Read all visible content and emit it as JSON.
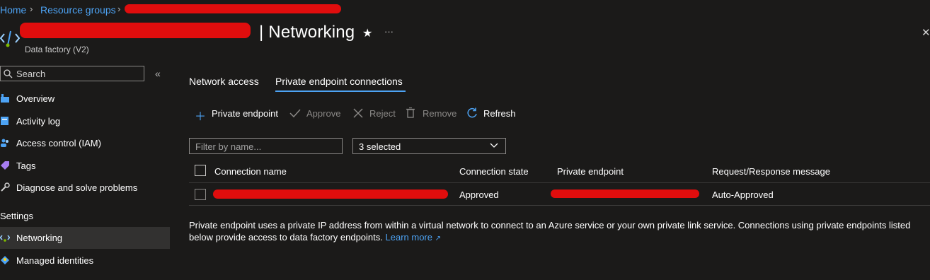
{
  "breadcrumb": {
    "home": "Home",
    "resource_groups": "Resource groups"
  },
  "header": {
    "title": "| Networking",
    "subtitle": "Data factory (V2)",
    "star_glyph": "★",
    "more_glyph": "···",
    "close_glyph": "✕"
  },
  "sidebar": {
    "search_placeholder": "Search",
    "collapse_glyph": "«",
    "items": [
      {
        "label": "Overview",
        "icon": "factory-icon"
      },
      {
        "label": "Activity log",
        "icon": "activity-log-icon"
      },
      {
        "label": "Access control (IAM)",
        "icon": "people-icon"
      },
      {
        "label": "Tags",
        "icon": "tag-icon"
      },
      {
        "label": "Diagnose and solve problems",
        "icon": "wrench-icon"
      }
    ],
    "section_settings": "Settings",
    "settings_items": [
      {
        "label": "Networking",
        "icon": "networking-icon",
        "selected": true
      },
      {
        "label": "Managed identities",
        "icon": "identity-icon"
      }
    ]
  },
  "tabs": [
    {
      "label": "Network access",
      "active": false
    },
    {
      "label": "Private endpoint connections",
      "active": true
    }
  ],
  "toolbar": {
    "private_endpoint": "Private endpoint",
    "approve": "Approve",
    "reject": "Reject",
    "remove": "Remove",
    "refresh": "Refresh"
  },
  "filters": {
    "name_placeholder": "Filter by name...",
    "state_selected": "3 selected"
  },
  "table": {
    "columns": [
      "Connection name",
      "Connection state",
      "Private endpoint",
      "Request/Response message"
    ],
    "rows": [
      {
        "connection_state": "Approved",
        "message": "Auto-Approved"
      }
    ]
  },
  "info": {
    "text": "Private endpoint uses a private IP address from within a virtual network to connect to an Azure service or your own private link service. Connections using private endpoints listed below provide access to data factory endpoints.",
    "learn_more": "Learn more"
  },
  "colors": {
    "background": "#1b1a19",
    "accent": "#4da3f4",
    "redaction": "#e00d0d"
  }
}
